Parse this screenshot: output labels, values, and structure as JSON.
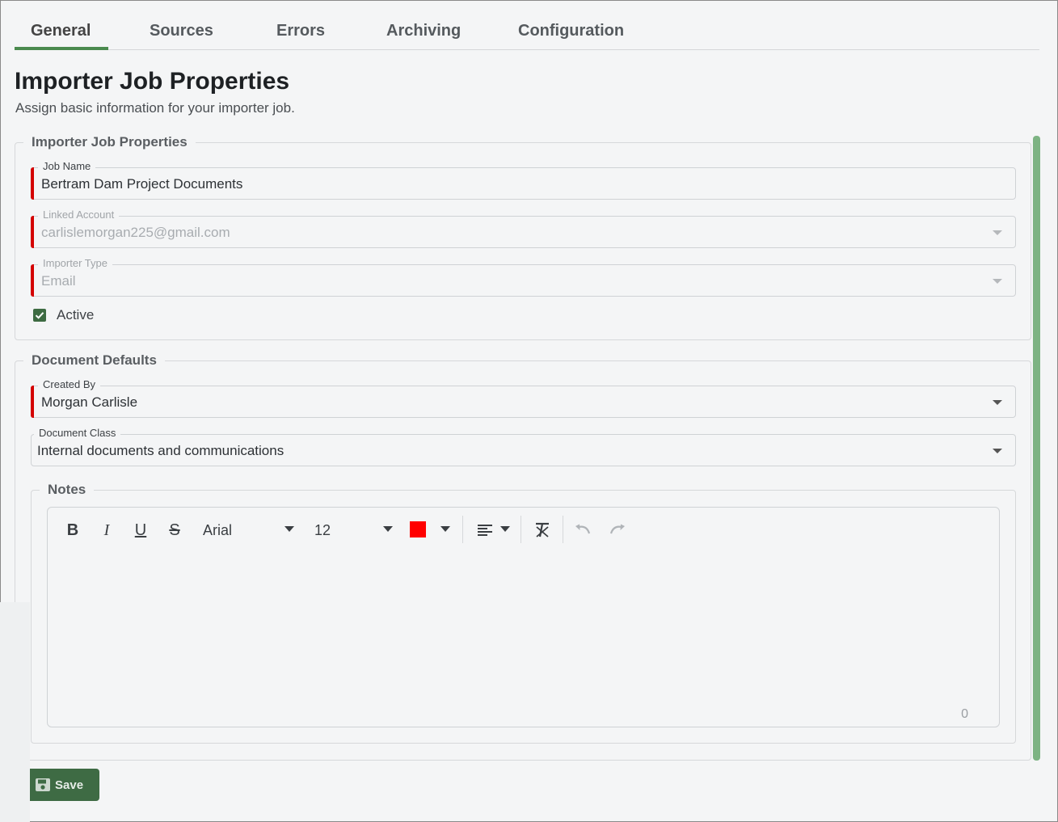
{
  "tabs": [
    {
      "label": "General",
      "active": true
    },
    {
      "label": "Sources"
    },
    {
      "label": "Errors"
    },
    {
      "label": "Archiving"
    },
    {
      "label": "Configuration"
    }
  ],
  "page": {
    "title": "Importer Job Properties",
    "subtitle": "Assign basic information for your importer job."
  },
  "job_properties": {
    "legend": "Importer Job Properties",
    "job_name": {
      "label": "Job Name",
      "value": "Bertram Dam Project Documents"
    },
    "linked_account": {
      "label": "Linked Account",
      "value": "carlislemorgan225@gmail.com"
    },
    "importer_type": {
      "label": "Importer Type",
      "value": "Email"
    },
    "active": {
      "label": "Active",
      "checked": true
    }
  },
  "document_defaults": {
    "legend": "Document Defaults",
    "created_by": {
      "label": "Created By",
      "value": "Morgan Carlisle"
    },
    "document_class": {
      "label": "Document Class",
      "value": "Internal documents and communications"
    },
    "notes": {
      "legend": "Notes",
      "font": "Arial",
      "font_size": "12",
      "text_color": "#ff0000",
      "char_count": "0"
    }
  },
  "save_button": {
    "label": "Save"
  },
  "colors": {
    "accent": "#4a8a4e",
    "required": "#d40000",
    "button": "#3e6b44"
  }
}
